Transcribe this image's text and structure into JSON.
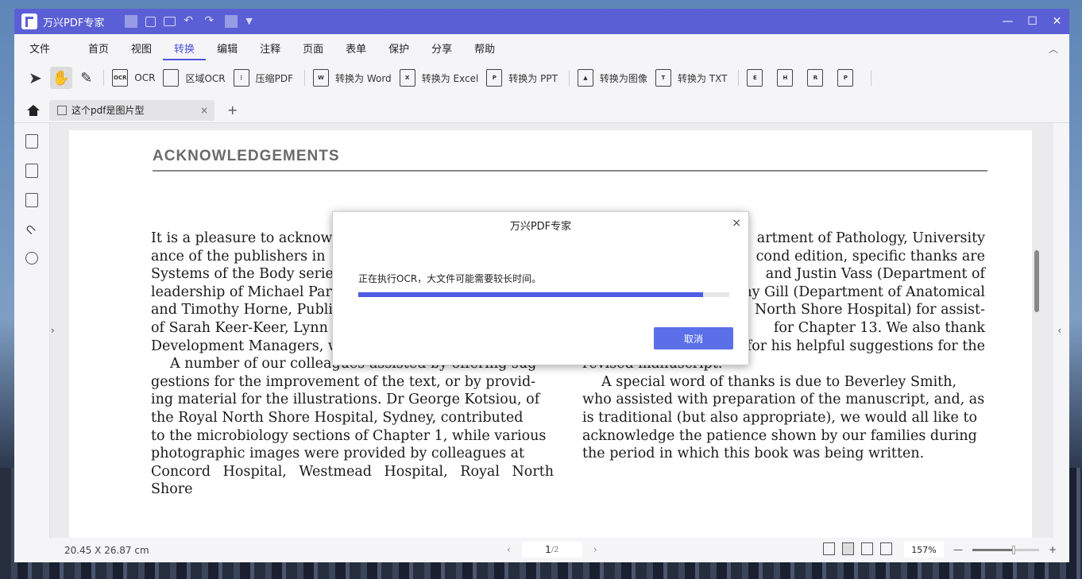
{
  "app": {
    "title": "万兴PDF专家",
    "window_controls": [
      "—",
      "☐",
      "✕"
    ]
  },
  "menu": [
    {
      "label": "文件",
      "active": false
    },
    {
      "label": "首页",
      "active": false
    },
    {
      "label": "视图",
      "active": false
    },
    {
      "label": "转换",
      "active": true
    },
    {
      "label": "编辑",
      "active": false
    },
    {
      "label": "注释",
      "active": false
    },
    {
      "label": "页面",
      "active": false
    },
    {
      "label": "表单",
      "active": false
    },
    {
      "label": "保护",
      "active": false
    },
    {
      "label": "分享",
      "active": false
    },
    {
      "label": "帮助",
      "active": false
    }
  ],
  "toolbar": {
    "ocr": "OCR",
    "area_ocr": "区域OCR",
    "compress": "压缩PDF",
    "to_word": "转换为  Word",
    "to_excel": "转换为  Excel",
    "to_ppt": "转换为  PPT",
    "to_image": "转换为图像",
    "to_txt": "转换为 TXT",
    "extra_icons": [
      "E",
      "H",
      "R",
      "P"
    ]
  },
  "tabs": {
    "doc_title": "这个pdf是图片型",
    "close": "×",
    "add": "+"
  },
  "document": {
    "heading": "ACKNOWLEDGEMENTS",
    "left_col": [
      "It is a pleasure to acknowl",
      "ance of the publishers in",
      "Systems of the Body serie",
      "leadership of Michael Par",
      "and Timothy Horne, Publi",
      "of Sarah Keer-Keer, Lynn",
      "Development Managers, w",
      "A number of our colleagues assisted by offering sug-",
      "gestions for the improvement of the text, or by provid-",
      "ing material for the illustrations. Dr George Kotsiou, of",
      "the Royal North Shore Hospital, Sydney, contributed",
      "to the microbiology sections of Chapter 1, while various",
      "photographic images were provided by colleagues at",
      "Concord Hospital, Westmead Hospital, Royal North Shore"
    ],
    "right_col": [
      "artment of Pathology, University",
      "cond edition, specific thanks are",
      "and Justin Vass (Department of",
      "ny Gill (Department of Anatomical",
      "North Shore Hospital) for assist-",
      "for Chapter 13. We also thank",
      "for his helpful suggestions for the",
      "revised manuscript.",
      "A special word of thanks is due to Beverley Smith,",
      "who assisted with preparation of the manuscript, and, as",
      "is traditional (but also appropriate), we would all like to",
      "acknowledge the patience shown by our families during",
      "the period in which this book was being written."
    ]
  },
  "status": {
    "page_size": "20.45 X 26.87 cm",
    "current_page": "1",
    "total_pages": "/2",
    "zoom": "157%",
    "zoom_minus": "—",
    "zoom_plus": "+",
    "zoom_level": 0.62
  },
  "dialog": {
    "title": "万兴PDF专家",
    "message": "正在执行OCR，大文件可能需要较长时间。",
    "progress": 0.93,
    "cancel": "取消",
    "close": "×"
  },
  "colors": {
    "titlebar": "#5b5fd6",
    "accent": "#4a55e0",
    "button": "#5a6fe8"
  }
}
